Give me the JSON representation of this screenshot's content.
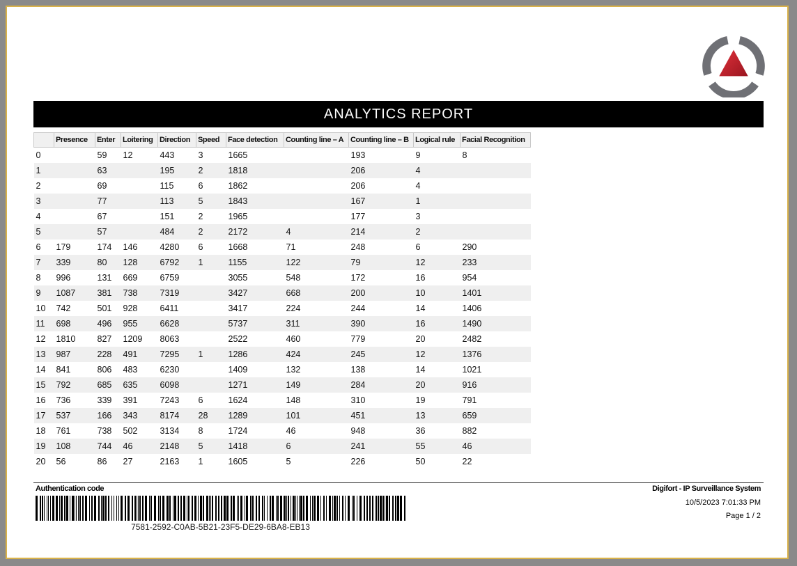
{
  "report": {
    "title": "ANALYTICS REPORT",
    "logo_icon": "digifort-triangle-logo-icon",
    "colors": {
      "banner": "#000000",
      "logo_red": "#c3202a",
      "logo_gray": "#6f7075",
      "row_stripe": "#efefef",
      "border_gold": "#d9b24a"
    }
  },
  "table": {
    "columns": [
      "",
      "Presence",
      "Enter",
      "Loitering",
      "Direction",
      "Speed",
      "Face detection",
      "Counting line – A",
      "Counting line – B",
      "Logical rule",
      "Facial Recognition"
    ],
    "rows": [
      [
        "0",
        "",
        "59",
        "12",
        "443",
        "3",
        "1665",
        "",
        "193",
        "9",
        "8"
      ],
      [
        "1",
        "",
        "63",
        "",
        "195",
        "2",
        "1818",
        "",
        "206",
        "4",
        ""
      ],
      [
        "2",
        "",
        "69",
        "",
        "115",
        "6",
        "1862",
        "",
        "206",
        "4",
        ""
      ],
      [
        "3",
        "",
        "77",
        "",
        "113",
        "5",
        "1843",
        "",
        "167",
        "1",
        ""
      ],
      [
        "4",
        "",
        "67",
        "",
        "151",
        "2",
        "1965",
        "",
        "177",
        "3",
        ""
      ],
      [
        "5",
        "",
        "57",
        "",
        "484",
        "2",
        "2172",
        "4",
        "214",
        "2",
        ""
      ],
      [
        "6",
        "179",
        "174",
        "146",
        "4280",
        "6",
        "1668",
        "71",
        "248",
        "6",
        "290"
      ],
      [
        "7",
        "339",
        "80",
        "128",
        "6792",
        "1",
        "1155",
        "122",
        "79",
        "12",
        "233"
      ],
      [
        "8",
        "996",
        "131",
        "669",
        "6759",
        "",
        "3055",
        "548",
        "172",
        "16",
        "954"
      ],
      [
        "9",
        "1087",
        "381",
        "738",
        "7319",
        "",
        "3427",
        "668",
        "200",
        "10",
        "1401"
      ],
      [
        "10",
        "742",
        "501",
        "928",
        "6411",
        "",
        "3417",
        "224",
        "244",
        "14",
        "1406"
      ],
      [
        "11",
        "698",
        "496",
        "955",
        "6628",
        "",
        "5737",
        "311",
        "390",
        "16",
        "1490"
      ],
      [
        "12",
        "1810",
        "827",
        "1209",
        "8063",
        "",
        "2522",
        "460",
        "779",
        "20",
        "2482"
      ],
      [
        "13",
        "987",
        "228",
        "491",
        "7295",
        "1",
        "1286",
        "424",
        "245",
        "12",
        "1376"
      ],
      [
        "14",
        "841",
        "806",
        "483",
        "6230",
        "",
        "1409",
        "132",
        "138",
        "14",
        "1021"
      ],
      [
        "15",
        "792",
        "685",
        "635",
        "6098",
        "",
        "1271",
        "149",
        "284",
        "20",
        "916"
      ],
      [
        "16",
        "736",
        "339",
        "391",
        "7243",
        "6",
        "1624",
        "148",
        "310",
        "19",
        "791"
      ],
      [
        "17",
        "537",
        "166",
        "343",
        "8174",
        "28",
        "1289",
        "101",
        "451",
        "13",
        "659"
      ],
      [
        "18",
        "761",
        "738",
        "502",
        "3134",
        "8",
        "1724",
        "46",
        "948",
        "36",
        "882"
      ],
      [
        "19",
        "108",
        "744",
        "46",
        "2148",
        "5",
        "1418",
        "6",
        "241",
        "55",
        "46"
      ],
      [
        "20",
        "56",
        "86",
        "27",
        "2163",
        "1",
        "1605",
        "5",
        "226",
        "50",
        "22"
      ]
    ]
  },
  "footer": {
    "auth_label": "Authentication code",
    "auth_code": "7581-2592-C0AB-5B21-23F5-DE29-6BA8-EB13",
    "system_name": "Digifort - IP Surveillance System",
    "datetime": "10/5/2023 7:01:33 PM",
    "page": "Page 1 / 2"
  }
}
